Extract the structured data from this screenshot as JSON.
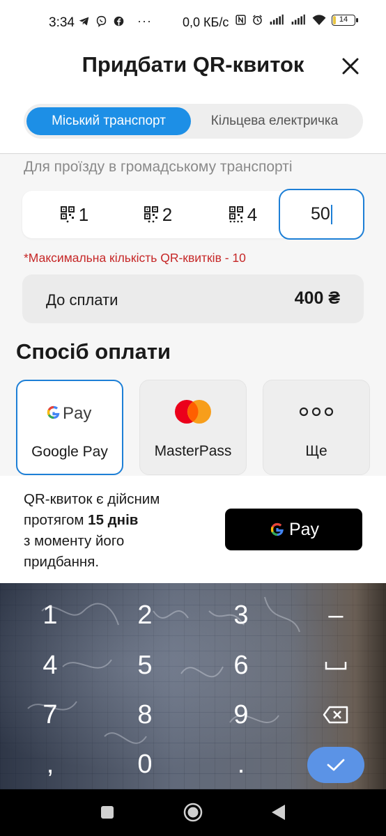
{
  "status_bar": {
    "time": "3:34",
    "left_icons": [
      "telegram-icon",
      "viber-icon",
      "facebook-icon"
    ],
    "more": "···",
    "net_speed": "0,0 КБ/с",
    "right_icons": [
      "nfc-icon",
      "alarm-icon",
      "signal-icon",
      "signal-icon",
      "wifi-icon"
    ],
    "battery": "14",
    "battery_level": 0.14
  },
  "header": {
    "title": "Придбати QR-квиток",
    "close_icon": "close-icon"
  },
  "tabs": [
    {
      "label": "Міський транспорт",
      "active": true
    },
    {
      "label": "Кільцева електричка",
      "active": false
    }
  ],
  "subtitle": "Для проїзду в громадському транспорті",
  "quantity": {
    "options": [
      {
        "label": "1",
        "icon": "qr-1-icon"
      },
      {
        "label": "2",
        "icon": "qr-2-icon"
      },
      {
        "label": "4",
        "icon": "qr-4-icon"
      }
    ],
    "input_value": "50",
    "max_note": "*Максимальна кількість QR-квитків - 10"
  },
  "payment": {
    "label": "До сплати",
    "amount": "400 ₴"
  },
  "methods": {
    "title": "Спосіб оплати",
    "items": [
      {
        "label": "Google Pay",
        "icon": "google-pay-icon",
        "selected": true
      },
      {
        "label": "MasterPass",
        "icon": "mastercard-icon",
        "selected": false
      },
      {
        "label": "Ще",
        "icon": "more-dots-icon",
        "selected": false
      }
    ]
  },
  "info": {
    "line1": "QR-квиток є дійсним",
    "line2_prefix": "протягом ",
    "line2_bold": "15 днів",
    "line3": "з моменту його",
    "line4": "придбання."
  },
  "pay_button": {
    "g": "G",
    "label": "Pay"
  },
  "keyboard": {
    "keys": [
      "1",
      "2",
      "3",
      "4",
      "5",
      "6",
      "7",
      "8",
      "9",
      ",",
      "0",
      "."
    ],
    "minus": "–"
  },
  "colors": {
    "accent": "#1d8fe6",
    "border_selected": "#1d7fd6",
    "warning": "#c62828",
    "enter_key": "#5b93e6"
  }
}
